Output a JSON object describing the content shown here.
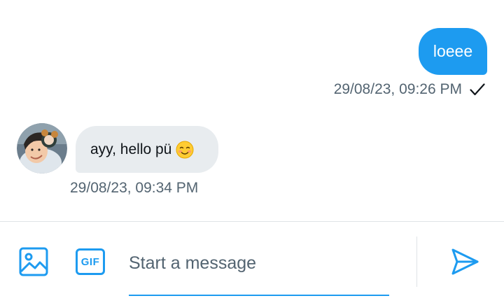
{
  "conversation": {
    "messages": [
      {
        "direction": "outgoing",
        "text": "loeee",
        "timestamp": "29/08/23, 09:26 PM",
        "status_icon": "check-icon"
      },
      {
        "direction": "incoming",
        "text": "ayy, hello pü",
        "emoji": "smiling-face-icon",
        "timestamp": "29/08/23, 09:34 PM",
        "sender_avatar": "avatar"
      }
    ]
  },
  "composer": {
    "placeholder": "Start a message",
    "value": "",
    "media_icon": "image-icon",
    "gif_label": "GIF",
    "send_icon": "send-icon"
  },
  "colors": {
    "accent": "#1d9bf0",
    "incoming_bubble": "#e8ecef",
    "meta_text": "#536471",
    "divider": "#dfe3e6"
  }
}
